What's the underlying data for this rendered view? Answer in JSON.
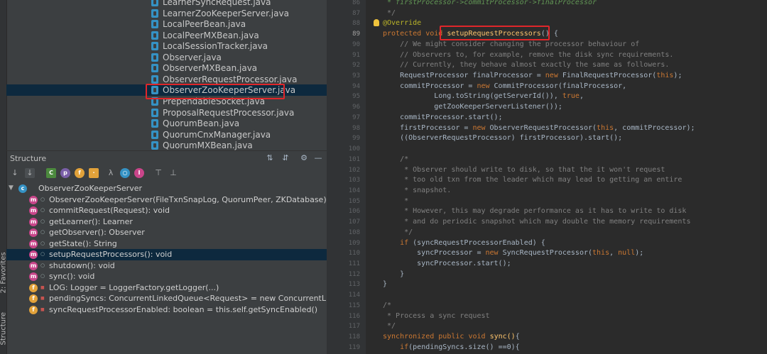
{
  "sidebar_tabs": {
    "favorites": "2: Favorites",
    "structure": "Structure"
  },
  "file_tree": {
    "items": [
      {
        "name": "LearnerSyncRequest.java"
      },
      {
        "name": "LearnerZooKeeperServer.java"
      },
      {
        "name": "LocalPeerBean.java"
      },
      {
        "name": "LocalPeerMXBean.java"
      },
      {
        "name": "LocalSessionTracker.java"
      },
      {
        "name": "Observer.java"
      },
      {
        "name": "ObserverMXBean.java"
      },
      {
        "name": "ObserverRequestProcessor.java"
      },
      {
        "name": "ObserverZooKeeperServer.java",
        "selected": true
      },
      {
        "name": "PrependableSocket.java"
      },
      {
        "name": "ProposalRequestProcessor.java"
      },
      {
        "name": "QuorumBean.java"
      },
      {
        "name": "QuorumCnxManager.java"
      },
      {
        "name": "QuorumMXBean.java"
      }
    ]
  },
  "structure_panel": {
    "title": "Structure",
    "root": "ObserverZooKeeperServer",
    "members": [
      {
        "kind": "m",
        "label": "ObserverZooKeeperServer(FileTxnSnapLog, QuorumPeer, ZKDatabase)"
      },
      {
        "kind": "m",
        "label": "commitRequest(Request): void"
      },
      {
        "kind": "m",
        "label": "getLearner(): Learner"
      },
      {
        "kind": "m",
        "label": "getObserver(): Observer"
      },
      {
        "kind": "m",
        "label": "getState(): String"
      },
      {
        "kind": "m",
        "label": "setupRequestProcessors(): void",
        "selected": true
      },
      {
        "kind": "m",
        "label": "shutdown(): void"
      },
      {
        "kind": "m",
        "label": "sync(): void"
      },
      {
        "kind": "f",
        "label": "LOG: Logger = LoggerFactory.getLogger(...)"
      },
      {
        "kind": "f",
        "label": "pendingSyncs: ConcurrentLinkedQueue<Request> = new ConcurrentLinkedQ"
      },
      {
        "kind": "f",
        "label": "syncRequestProcessorEnabled: boolean = this.self.getSyncEnabled()"
      }
    ]
  },
  "editor": {
    "current_line": "89",
    "lines": [
      {
        "n": "86",
        "t": " * firstProcessor->commitProcessor->finalProcessor"
      },
      {
        "n": "87",
        "t": " */"
      },
      {
        "n": "88",
        "t": "@Override"
      },
      {
        "n": "89",
        "t": "protected void setupRequestProcessors() {"
      },
      {
        "n": "90",
        "t": "    // We might consider changing the processor behaviour of"
      },
      {
        "n": "91",
        "t": "    // Observers to, for example, remove the disk sync requirements."
      },
      {
        "n": "92",
        "t": "    // Currently, they behave almost exactly the same as followers."
      },
      {
        "n": "93",
        "t": "    RequestProcessor finalProcessor = new FinalRequestProcessor(this);"
      },
      {
        "n": "94",
        "t": "    commitProcessor = new CommitProcessor(finalProcessor,"
      },
      {
        "n": "95",
        "t": "            Long.toString(getServerId()), true,"
      },
      {
        "n": "96",
        "t": "            getZooKeeperServerListener());"
      },
      {
        "n": "97",
        "t": "    commitProcessor.start();"
      },
      {
        "n": "98",
        "t": "    firstProcessor = new ObserverRequestProcessor(this, commitProcessor);"
      },
      {
        "n": "99",
        "t": "    ((ObserverRequestProcessor) firstProcessor).start();"
      },
      {
        "n": "100",
        "t": ""
      },
      {
        "n": "101",
        "t": "    /*"
      },
      {
        "n": "102",
        "t": "     * Observer should write to disk, so that the it won't request"
      },
      {
        "n": "103",
        "t": "     * too old txn from the leader which may lead to getting an entire"
      },
      {
        "n": "104",
        "t": "     * snapshot."
      },
      {
        "n": "105",
        "t": "     *"
      },
      {
        "n": "106",
        "t": "     * However, this may degrade performance as it has to write to disk"
      },
      {
        "n": "107",
        "t": "     * and do periodic snapshot which may double the memory requirements"
      },
      {
        "n": "108",
        "t": "     */"
      },
      {
        "n": "109",
        "t": "    if (syncRequestProcessorEnabled) {"
      },
      {
        "n": "110",
        "t": "        syncProcessor = new SyncRequestProcessor(this, null);"
      },
      {
        "n": "111",
        "t": "        syncProcessor.start();"
      },
      {
        "n": "112",
        "t": "    }"
      },
      {
        "n": "113",
        "t": "}"
      },
      {
        "n": "114",
        "t": ""
      },
      {
        "n": "115",
        "t": "/*"
      },
      {
        "n": "116",
        "t": " * Process a sync request"
      },
      {
        "n": "117",
        "t": " */"
      },
      {
        "n": "118",
        "t": "synchronized public void sync(){"
      },
      {
        "n": "119",
        "t": "    if(pendingSyncs.size() ==0){"
      }
    ]
  },
  "colors": {
    "highlight_box": "#e0262a",
    "selection": "#0d293e",
    "method_icon": "#c9458a",
    "field_icon": "#e2a23a"
  }
}
